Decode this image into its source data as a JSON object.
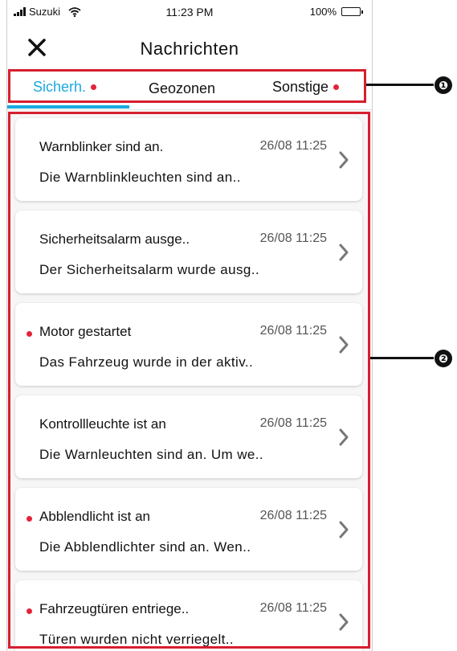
{
  "statusbar": {
    "carrier": "Suzuki",
    "time": "11:23 PM",
    "battery": "100%"
  },
  "header": {
    "title": "Nachrichten"
  },
  "tabs": [
    {
      "label": "Sicherh.",
      "active": true,
      "unread": true
    },
    {
      "label": "Geozonen",
      "active": false,
      "unread": false
    },
    {
      "label": "Sonstige",
      "active": false,
      "unread": true
    }
  ],
  "messages": [
    {
      "title": "Warnblinker sind an.",
      "time": "26/08 11:25",
      "body": "Die Warnblinkleuchten sind an..",
      "unread": false
    },
    {
      "title": "Sicherheitsalarm ausge..",
      "time": "26/08 11:25",
      "body": "Der Sicherheitsalarm wurde ausg..",
      "unread": false
    },
    {
      "title": "Motor gestartet",
      "time": "26/08 11:25",
      "body": "Das Fahrzeug wurde in der aktiv..",
      "unread": true
    },
    {
      "title": "Kontrollleuchte ist an",
      "time": "26/08 11:25",
      "body": "Die Warnleuchten sind an. Um we..",
      "unread": false
    },
    {
      "title": "Abblendlicht ist an",
      "time": "26/08 11:25",
      "body": "Die Abblendlichter sind an. Wen..",
      "unread": true
    },
    {
      "title": "Fahrzeugtüren entriege..",
      "time": "26/08 11:25",
      "body": "Türen wurden nicht verriegelt..",
      "unread": true
    }
  ],
  "annotations": {
    "one": "❶",
    "two": "❷"
  },
  "colors": {
    "accent": "#1aa9e0",
    "unread_dot": "#e4233a",
    "annotation_box": "#d61f2e"
  }
}
